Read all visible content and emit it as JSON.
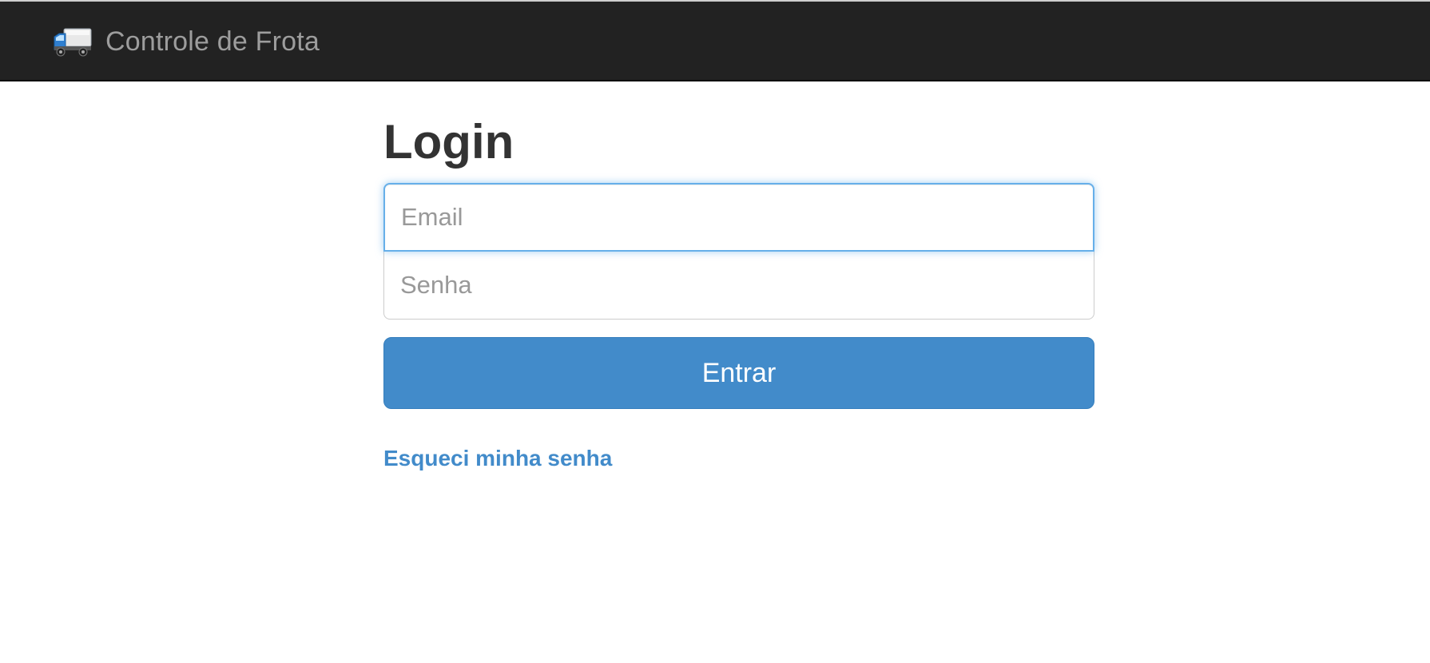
{
  "navbar": {
    "brand_text": "Controle de Frota",
    "brand_icon": "truck-icon"
  },
  "login": {
    "title": "Login",
    "email_placeholder": "Email",
    "email_value": "",
    "password_placeholder": "Senha",
    "password_value": "",
    "submit_label": "Entrar",
    "forgot_link": "Esqueci minha senha"
  },
  "colors": {
    "navbar_bg": "#222222",
    "brand_text": "#9d9d9d",
    "primary": "#428bca",
    "focus_border": "#66afe9",
    "title_text": "#333333"
  }
}
